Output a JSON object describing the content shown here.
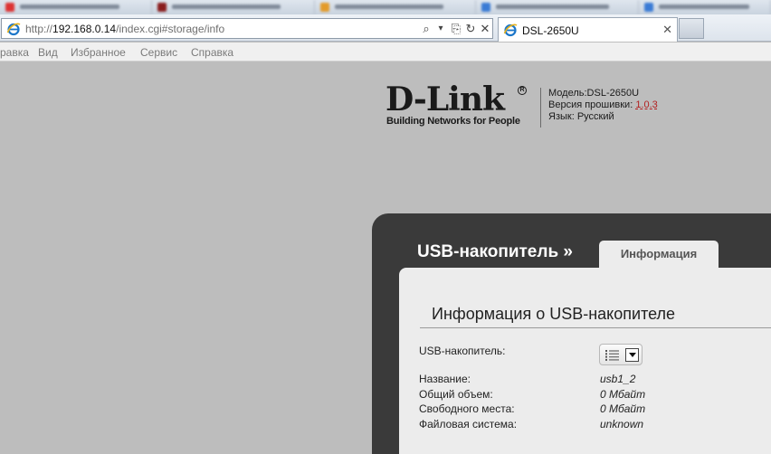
{
  "browser": {
    "url_prefix": "http://",
    "url_host": "192.168.0.14",
    "url_path": "/index.cgi#storage/info",
    "tab_title": "DSL-2650U",
    "tab_close": "✕",
    "addr_search_glyph": "⌕",
    "addr_dropdown_glyph": "▾",
    "addr_compat_glyph": "⎘",
    "addr_refresh_glyph": "↻",
    "addr_stop_glyph": "✕"
  },
  "menu": {
    "items": [
      "равка",
      "Вид",
      "Избранное",
      "Сервис",
      "Справка"
    ]
  },
  "header": {
    "logo_text": "D-Link",
    "logo_reg": "R",
    "logo_tagline": "Building Networks for People",
    "model_label": "Модель:",
    "model_value": "DSL-2650U",
    "firmware_label": "Версия прошивки:",
    "firmware_value": "1.0.3",
    "language_label": "Язык:",
    "language_value": "Русский"
  },
  "content": {
    "section_title": "USB-накопитель »",
    "active_tab": "Информация",
    "title": "Информация о USB-накопителе",
    "usb_label": "USB-накопитель:",
    "fields": [
      {
        "label": "Название:",
        "value": "usb1_2"
      },
      {
        "label": "Общий объем:",
        "value": "0 Мбайт"
      },
      {
        "label": "Свободного места:",
        "value": "0 Мбайт"
      },
      {
        "label": "Файловая система:",
        "value": "unknown"
      }
    ]
  },
  "colors": {
    "background": "#bdbdbd",
    "panel_dark": "#3a3a3a",
    "panel_light": "#ececec",
    "firmware_link": "#b21f1f"
  }
}
